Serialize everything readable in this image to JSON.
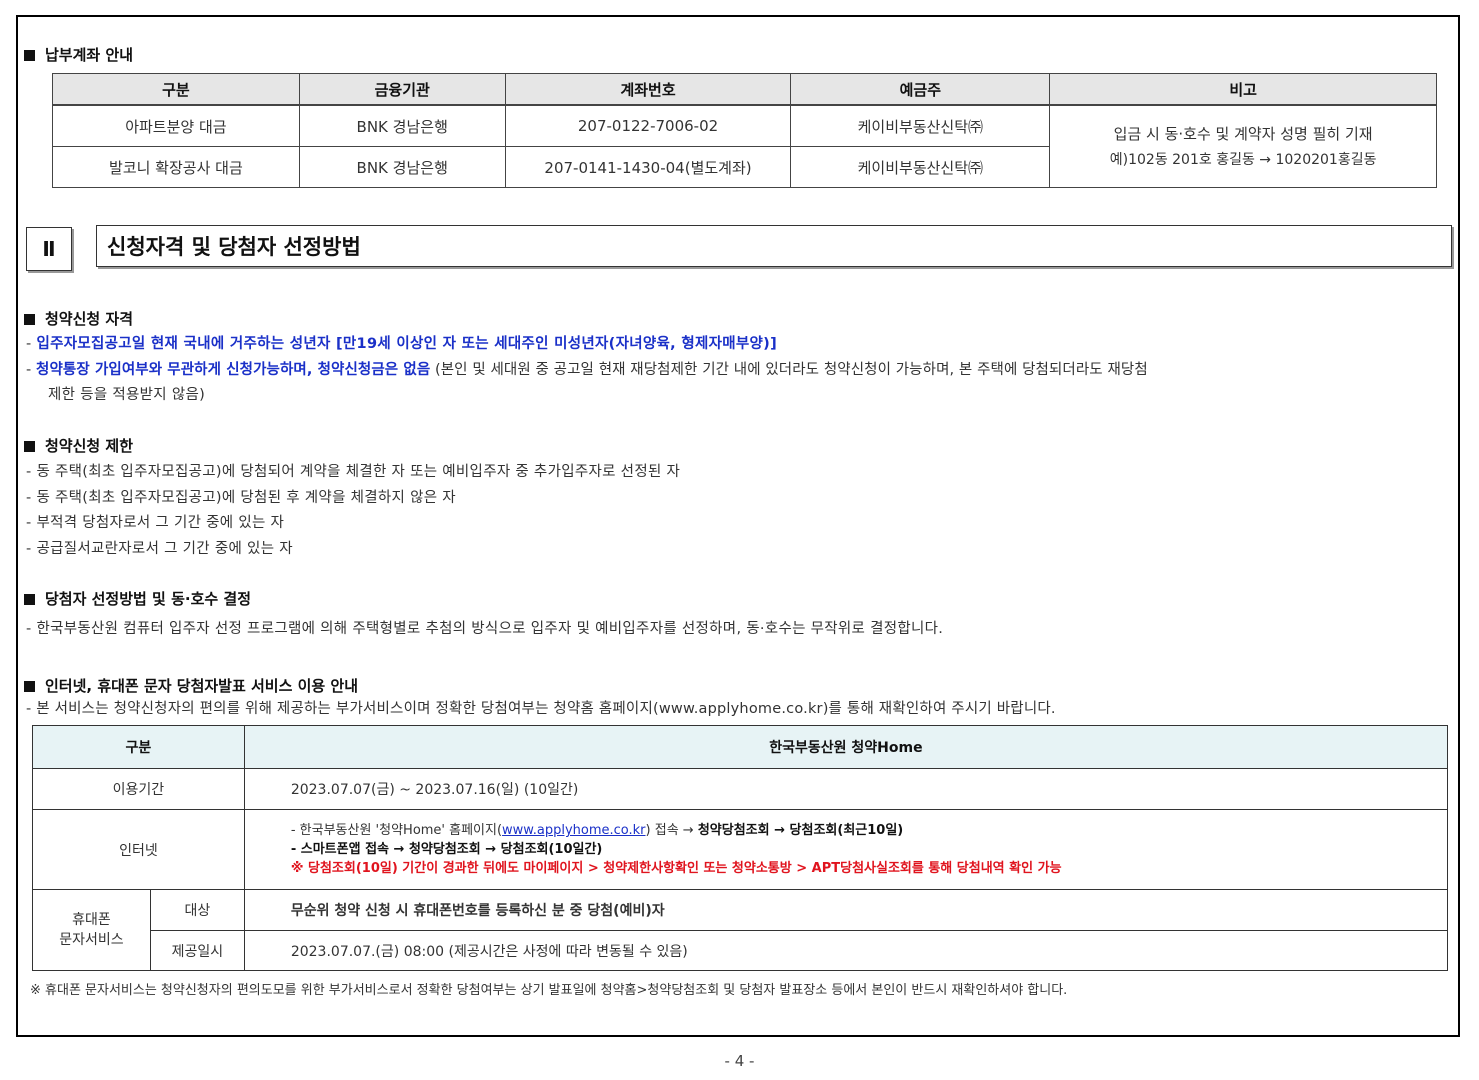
{
  "account": {
    "heading": "납부계좌 안내",
    "headers": [
      "구분",
      "금융기관",
      "계좌번호",
      "예금주",
      "비고"
    ],
    "rows": [
      [
        "아파트분양 대금",
        "BNK 경남은행",
        "207-0122-7006-02",
        "케이비부동산신탁㈜"
      ],
      [
        "발코니 확장공사 대금",
        "BNK 경남은행",
        "207-0141-1430-04(별도계좌)",
        "케이비부동산신탁㈜"
      ]
    ],
    "note_line1": "입금 시 동·호수 및 계약자 성명 필히 기재",
    "note_line2": "예)102동 201호 홍길동 → 1020201홍길동"
  },
  "section2": {
    "number": "Ⅱ",
    "title": "신청자격 및 당첨자 선정방법"
  },
  "eligibility": {
    "heading": "청약신청 자격",
    "line1": "입주자모집공고일 현재 국내에 거주하는 성년자 [만19세 이상인 자 또는 세대주인 미성년자(자녀양육, 형제자매부양)]",
    "line2_bold": "청약통장 가입여부와 무관하게 신청가능하며, 청약신청금은 없음",
    "line2_rest": " (본인 및 세대원 중 공고일 현재 재당첨제한 기간 내에 있더라도 청약신청이 가능하며, 본 주택에 당첨되더라도 재당첨",
    "line3": "제한 등을 적용받지 않음)"
  },
  "restriction": {
    "heading": "청약신청 제한",
    "items": [
      "동 주택(최초 입주자모집공고)에 당첨되어 계약을 체결한 자 또는 예비입주자 중 추가입주자로 선정된 자",
      "동 주택(최초 입주자모집공고)에 당첨된 후 계약을 체결하지 않은 자",
      "부적격 당첨자로서 그 기간 중에 있는 자",
      "공급질서교란자로서 그 기간 중에 있는 자"
    ]
  },
  "selection": {
    "heading": "당첨자 선정방법 및 동·호수 결정",
    "line": "한국부동산원 컴퓨터 입주자 선정 프로그램에 의해 주택형별로 추첨의 방식으로 입주자 및 예비입주자를 선정하며, 동·호수는 무작위로 결정합니다."
  },
  "service": {
    "heading": "인터넷, 휴대폰 문자 당첨자발표 서비스 이용 안내",
    "intro": "본 서비스는 청약신청자의 편의를 위해 제공하는 부가서비스이며 정확한 당첨여부는 청약홈 홈페이지(www.applyhome.co.kr)를 통해 재확인하여 주시기 바랍니다.",
    "header_left": "구분",
    "header_right": "한국부동산원 청약Home",
    "period_label": "이용기간",
    "period_value": "2023.07.07(금) ~ 2023.07.16(일) (10일간)",
    "internet_label": "인터넷",
    "internet_l1_a": "- 한국부동산원 '청약Home' 홈페이지(",
    "internet_l1_link": "www.applyhome.co.kr",
    "internet_l1_b": ") 접속 → ",
    "internet_l1_bold": "청약당첨조회 → 당첨조회(최근10일)",
    "internet_l2": "- 스마트폰앱 접속  → 청약당첨조회 → 당첨조회(10일간)",
    "internet_l3": "※ 당첨조회(10일) 기간이 경과한 뒤에도 마이페이지 > 청약제한사항확인 또는 청약소통방 > APT당첨사실조회를 통해 당첨내역 확인 가능",
    "mobile_label_1": "휴대폰",
    "mobile_label_2": "문자서비스",
    "target_label": "대상",
    "target_value": "무순위 청약 신청 시 휴대폰번호를 등록하신 분 중 당첨(예비)자",
    "date_label": "제공일시",
    "date_value": "2023.07.07.(금) 08:00 (제공시간은 사정에 따라 변동될 수 있음)",
    "footnote": "※ 휴대폰 문자서비스는 청약신청자의 편의도모를 위한 부가서비스로서 정확한 당첨여부는 상기 발표일에 청약홈>청약당첨조회 및 당첨자 발표장소 등에서 본인이 반드시 재확인하셔야 합니다."
  },
  "page_number": "- 4 -"
}
